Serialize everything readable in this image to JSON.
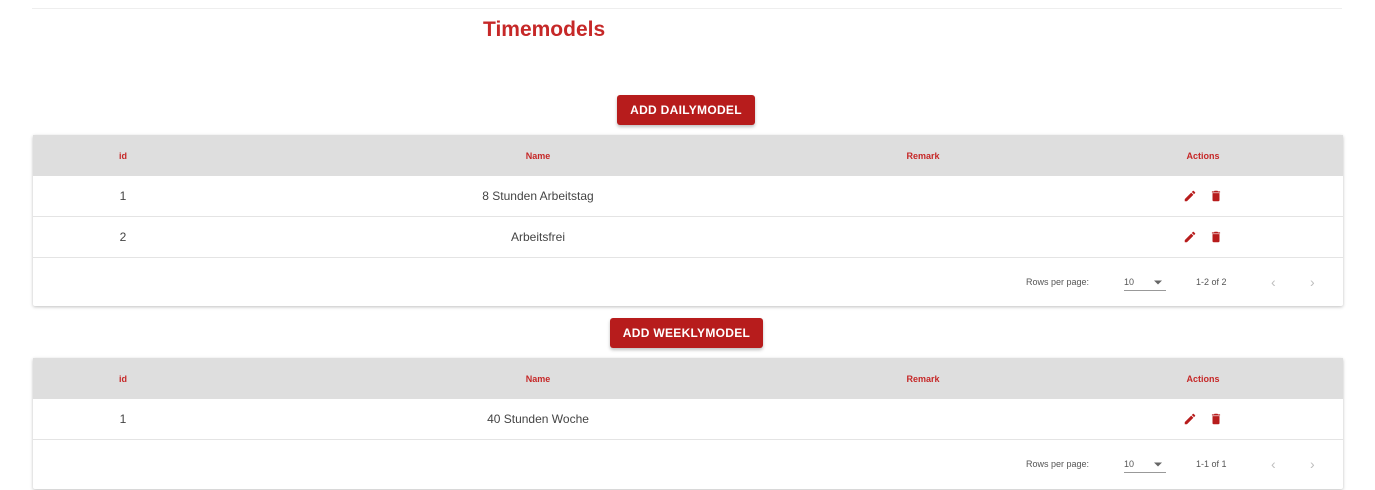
{
  "page": {
    "title": "Timemodels"
  },
  "daily": {
    "add_label": "ADD DAILYMODEL",
    "columns": {
      "id": "id",
      "name": "Name",
      "remark": "Remark",
      "actions": "Actions"
    },
    "rows": [
      {
        "id": "1",
        "name": "8 Stunden Arbeitstag",
        "remark": ""
      },
      {
        "id": "2",
        "name": "Arbeitsfrei",
        "remark": ""
      }
    ],
    "pager": {
      "rows_per_page_label": "Rows per page:",
      "rows_per_page": "10",
      "range": "1-2 of 2"
    }
  },
  "weekly": {
    "add_label": "ADD WEEKLYMODEL",
    "columns": {
      "id": "id",
      "name": "Name",
      "remark": "Remark",
      "actions": "Actions"
    },
    "rows": [
      {
        "id": "1",
        "name": "40 Stunden Woche",
        "remark": ""
      }
    ],
    "pager": {
      "rows_per_page_label": "Rows per page:",
      "rows_per_page": "10",
      "range": "1-1 of 1"
    }
  },
  "icons": {
    "edit": "pencil-icon",
    "delete": "trash-icon",
    "dropdown": "caret-down-icon",
    "prev": "chevron-left-icon",
    "next": "chevron-right-icon"
  },
  "colors": {
    "accent": "#c62828",
    "button": "#b71c1c",
    "header_bg": "#dedede"
  }
}
